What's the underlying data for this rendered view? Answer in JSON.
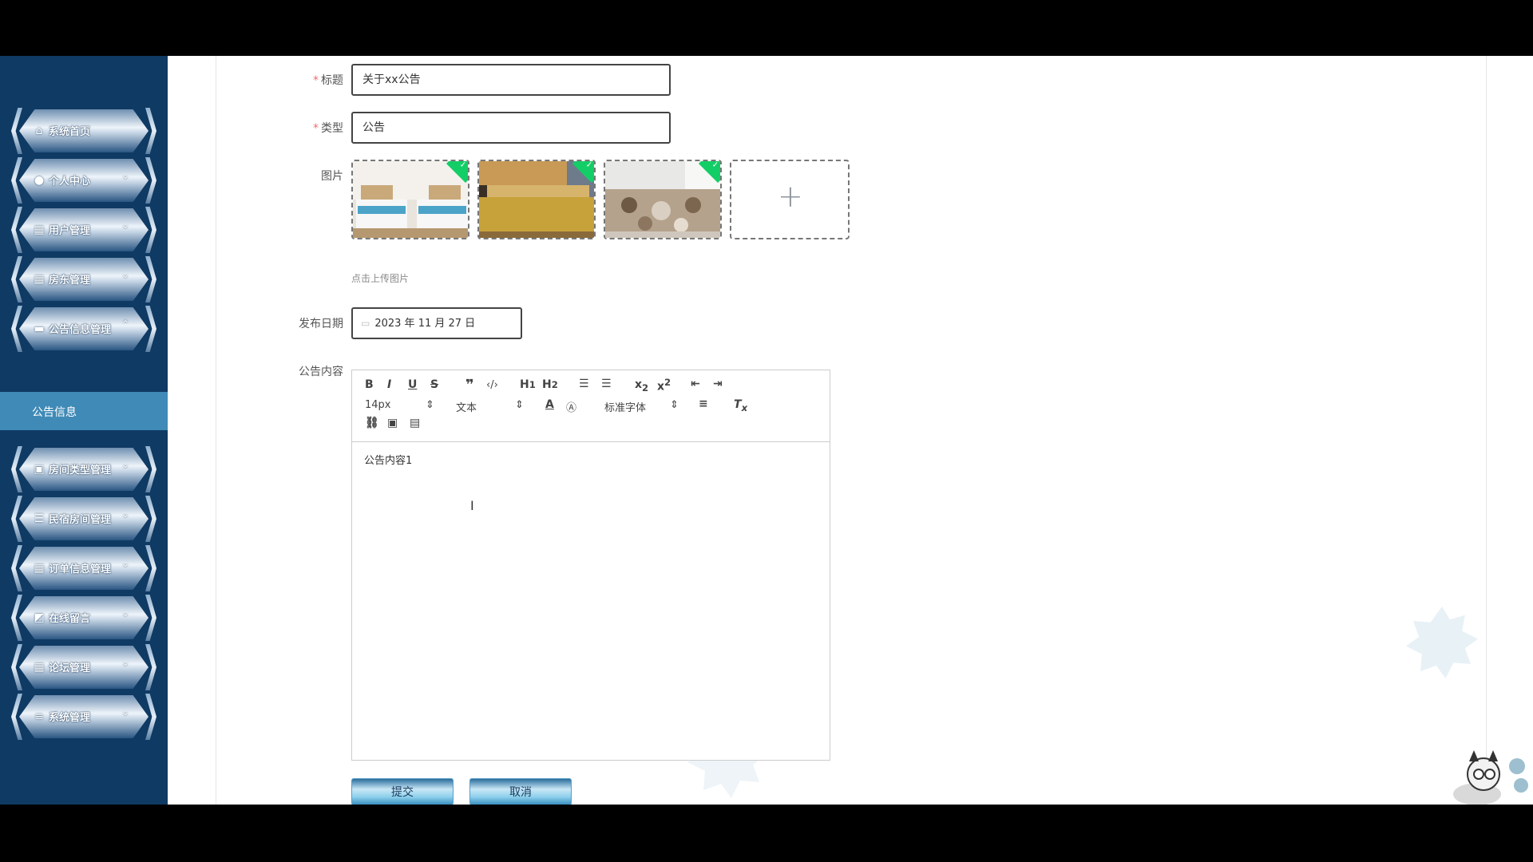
{
  "sidebar": {
    "items": [
      {
        "label": "系统首页",
        "icon": "home-icon",
        "glyph": "⌂",
        "chevron": ""
      },
      {
        "label": "个人中心",
        "icon": "user-icon",
        "glyph": "●",
        "chevron": "⌄"
      },
      {
        "label": "用户管理",
        "icon": "grid-icon",
        "glyph": "▦",
        "chevron": "⌄"
      },
      {
        "label": "房东管理",
        "icon": "grid-icon",
        "glyph": "▦",
        "chevron": "⌄"
      },
      {
        "label": "公告信息管理",
        "icon": "ticket-icon",
        "glyph": "▬",
        "chevron": "⌃"
      },
      {
        "label": "房间类型管理",
        "icon": "briefcase-icon",
        "glyph": "▣",
        "chevron": "⌄"
      },
      {
        "label": "民宿房间管理",
        "icon": "sliders-icon",
        "glyph": "☰",
        "chevron": "⌄"
      },
      {
        "label": "订单信息管理",
        "icon": "grid-icon",
        "glyph": "▦",
        "chevron": "⌄"
      },
      {
        "label": "在线留言",
        "icon": "chart-icon",
        "glyph": "◩",
        "chevron": "⌄"
      },
      {
        "label": "论坛管理",
        "icon": "grid-icon",
        "glyph": "▦",
        "chevron": "⌄"
      },
      {
        "label": "系统管理",
        "icon": "menu-icon",
        "glyph": "≡",
        "chevron": "⌄"
      }
    ],
    "submenu_active": "公告信息"
  },
  "form": {
    "title_label": "标题",
    "title_value": "关于xx公告",
    "type_label": "类型",
    "type_value": "公告",
    "image_label": "图片",
    "upload_hint": "点击上传图片",
    "upload_plus": "+",
    "date_label": "发布日期",
    "date_value": "2023 年 11 月 27 日",
    "content_label": "公告内容",
    "content_value": "公告内容1",
    "submit_label": "提交",
    "cancel_label": "取消"
  },
  "editor_toolbar": {
    "font_size": "14px",
    "block_format": "文本",
    "font_family": "标准字体"
  },
  "colors": {
    "sidebar_bg": "#0f3a63",
    "submenu_active_bg": "#3f8ab7",
    "required": "#f56c6c",
    "upload_success": "#13ce66"
  }
}
